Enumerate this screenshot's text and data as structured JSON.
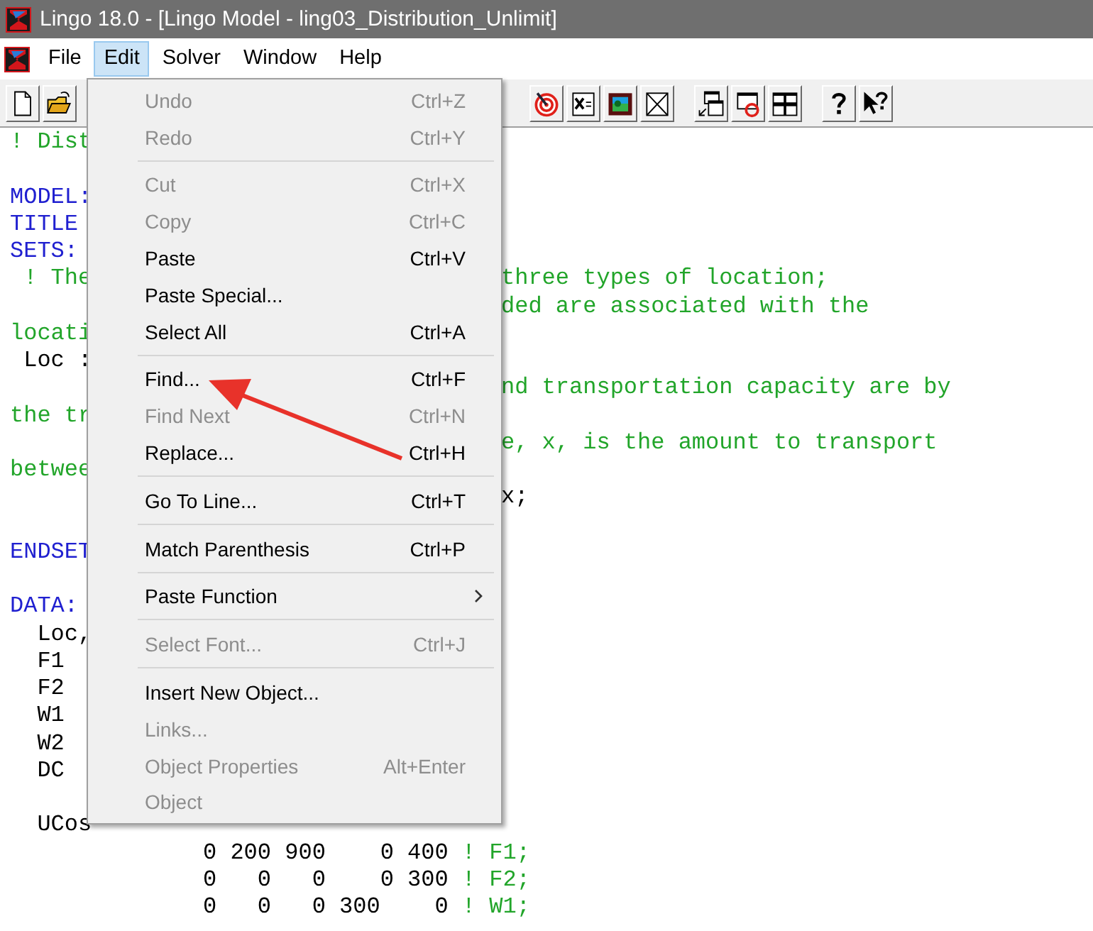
{
  "window": {
    "title": "Lingo 18.0 - [Lingo Model - ling03_Distribution_Unlimit]"
  },
  "menu_bar": [
    {
      "label": "File",
      "selected": false
    },
    {
      "label": "Edit",
      "selected": true
    },
    {
      "label": "Solver",
      "selected": false
    },
    {
      "label": "Window",
      "selected": false
    },
    {
      "label": "Help",
      "selected": false
    }
  ],
  "editor": {
    "lines": [
      {
        "kind": "code",
        "left": [
          {
            "text": "! Dist",
            "kind": "comment"
          }
        ]
      },
      {
        "kind": "code"
      },
      {
        "kind": "code",
        "left": [
          {
            "text": "MODEL:",
            "kind": "keyword"
          }
        ]
      },
      {
        "kind": "code",
        "left": [
          {
            "text": "TITLE",
            "kind": "keyword"
          }
        ]
      },
      {
        "kind": "code",
        "left": [
          {
            "text": "SETS:",
            "kind": "keyword"
          }
        ]
      },
      {
        "kind": "code",
        "left": [
          {
            "text": " ! The",
            "kind": "comment"
          }
        ],
        "right": [
          {
            "text": "three types of location;",
            "kind": "comment"
          }
        ]
      },
      {
        "kind": "code",
        "right": [
          {
            "text": "ded are associated with the",
            "kind": "comment"
          }
        ]
      },
      {
        "kind": "code",
        "left": [
          {
            "text": "locati",
            "kind": "comment"
          }
        ]
      },
      {
        "kind": "code",
        "left": [
          {
            "text": " Loc :",
            "kind": "plain"
          }
        ]
      },
      {
        "kind": "code",
        "right": [
          {
            "text": "nd transportation capacity are by",
            "kind": "comment"
          }
        ]
      },
      {
        "kind": "code",
        "left": [
          {
            "text": "the tr",
            "kind": "comment"
          }
        ]
      },
      {
        "kind": "code",
        "right": [
          {
            "text": "e, x, is the amount to transport",
            "kind": "comment"
          }
        ]
      },
      {
        "kind": "code",
        "left": [
          {
            "text": "betwee",
            "kind": "comment"
          }
        ]
      },
      {
        "kind": "code",
        "right": [
          {
            "text": "x;",
            "kind": "plain"
          }
        ]
      },
      {
        "kind": "code"
      },
      {
        "kind": "code",
        "left": [
          {
            "text": "ENDSET",
            "kind": "keyword"
          }
        ]
      },
      {
        "kind": "code"
      },
      {
        "kind": "code",
        "left": [
          {
            "text": "DATA:",
            "kind": "keyword"
          }
        ]
      },
      {
        "kind": "code",
        "left": [
          {
            "text": "  Loc,",
            "kind": "plain"
          }
        ]
      },
      {
        "kind": "code",
        "left": [
          {
            "text": "  F1",
            "kind": "plain"
          }
        ]
      },
      {
        "kind": "code",
        "left": [
          {
            "text": "  F2",
            "kind": "plain"
          }
        ]
      },
      {
        "kind": "code",
        "left": [
          {
            "text": "  W1",
            "kind": "plain"
          }
        ]
      },
      {
        "kind": "code",
        "left": [
          {
            "text": "  W2",
            "kind": "plain"
          }
        ]
      },
      {
        "kind": "code",
        "left": [
          {
            "text": "  DC",
            "kind": "plain"
          }
        ]
      },
      {
        "kind": "code"
      },
      {
        "kind": "code",
        "left": [
          {
            "text": "  UCos",
            "kind": "plain"
          }
        ]
      },
      {
        "kind": "table",
        "segments": [
          {
            "text": "0 200 900    0 400",
            "kind": "plain"
          },
          {
            "text": "! F1;",
            "kind": "comment"
          }
        ]
      },
      {
        "kind": "table",
        "segments": [
          {
            "text": "0   0   0    0 300",
            "kind": "plain"
          },
          {
            "text": "! F2;",
            "kind": "comment"
          }
        ]
      },
      {
        "kind": "table",
        "segments": [
          {
            "text": "0   0   0 300    0",
            "kind": "plain"
          },
          {
            "text": "! W1;",
            "kind": "comment"
          }
        ]
      }
    ]
  },
  "edit_menu": {
    "items": [
      {
        "kind": "item",
        "label": "Undo",
        "shortcut": "Ctrl+Z",
        "disabled": true
      },
      {
        "kind": "item",
        "label": "Redo",
        "shortcut": "Ctrl+Y",
        "disabled": true
      },
      {
        "kind": "separator"
      },
      {
        "kind": "item",
        "label": "Cut",
        "shortcut": "Ctrl+X",
        "disabled": true
      },
      {
        "kind": "item",
        "label": "Copy",
        "shortcut": "Ctrl+C",
        "disabled": true
      },
      {
        "kind": "item",
        "label": "Paste",
        "shortcut": "Ctrl+V",
        "disabled": false
      },
      {
        "kind": "item",
        "label": "Paste Special...",
        "disabled": false
      },
      {
        "kind": "item",
        "label": "Select All",
        "shortcut": "Ctrl+A",
        "disabled": false
      },
      {
        "kind": "separator"
      },
      {
        "kind": "item",
        "label": "Find...",
        "shortcut": "Ctrl+F",
        "disabled": false
      },
      {
        "kind": "item",
        "label": "Find Next",
        "shortcut": "Ctrl+N",
        "disabled": true
      },
      {
        "kind": "item",
        "label": "Replace...",
        "shortcut": "Ctrl+H",
        "disabled": false
      },
      {
        "kind": "separator"
      },
      {
        "kind": "item",
        "label": "Go To Line...",
        "shortcut": "Ctrl+T",
        "disabled": false
      },
      {
        "kind": "separator"
      },
      {
        "kind": "item",
        "label": "Match Parenthesis",
        "shortcut": "Ctrl+P",
        "disabled": false
      },
      {
        "kind": "separator"
      },
      {
        "kind": "submenu",
        "label": "Paste Function",
        "disabled": false
      },
      {
        "kind": "separator"
      },
      {
        "kind": "item",
        "label": "Select Font...",
        "shortcut": "Ctrl+J",
        "disabled": true
      },
      {
        "kind": "separator"
      },
      {
        "kind": "item",
        "label": "Insert New Object...",
        "disabled": false
      },
      {
        "kind": "item",
        "label": "Links...",
        "disabled": true
      },
      {
        "kind": "item",
        "label": "Object Properties",
        "shortcut": "Alt+Enter",
        "disabled": true
      },
      {
        "kind": "item",
        "label": "Object",
        "disabled": true
      }
    ]
  }
}
